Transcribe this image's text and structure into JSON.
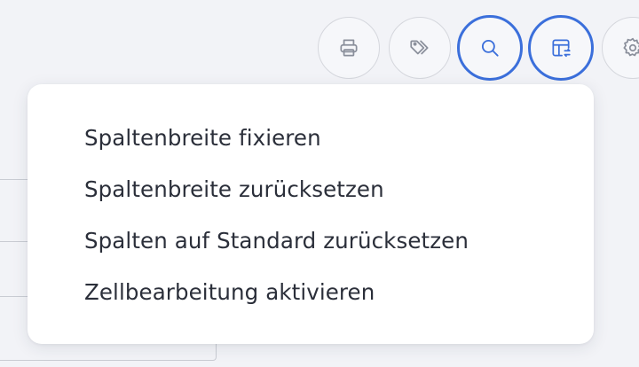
{
  "toolbar": {
    "buttons": [
      {
        "icon": "printer-icon",
        "active": false
      },
      {
        "icon": "tags-icon",
        "active": false
      },
      {
        "icon": "search-icon",
        "active": true
      },
      {
        "icon": "table-refresh-icon",
        "active": true
      },
      {
        "icon": "gear-icon",
        "active": false
      }
    ],
    "accent_color": "#3b6fdb"
  },
  "menu": {
    "items": [
      {
        "label": "Spaltenbreite fixieren"
      },
      {
        "label": "Spaltenbreite zurücksetzen"
      },
      {
        "label": "Spalten auf Standard zurücksetzen"
      },
      {
        "label": "Zellbearbeitung aktivieren"
      }
    ]
  }
}
